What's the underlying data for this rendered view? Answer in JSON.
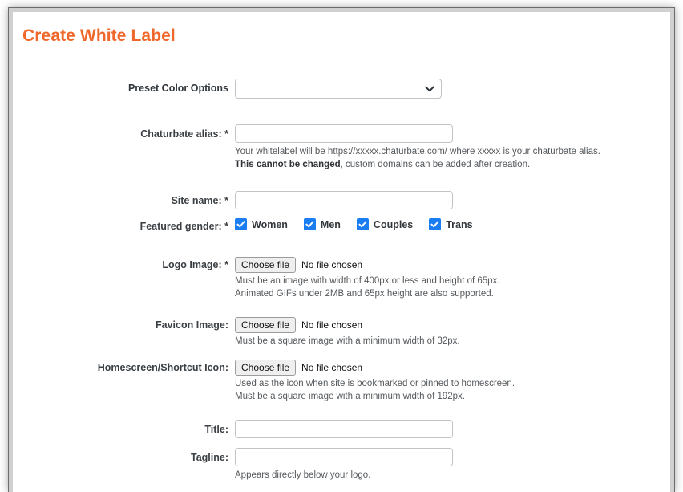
{
  "card": {
    "title": "Create White Label"
  },
  "form": {
    "preset_color": {
      "label": "Preset Color Options",
      "selected": "",
      "arrow_icon": "chevron-down-icon"
    },
    "chaturbate_alias": {
      "label": "Chaturbate alias: *",
      "value": "",
      "help_line_1": "Your whitelabel will be https://xxxxx.chaturbate.com/ where xxxxx is your chaturbate alias.",
      "help_line_2_bold": "This cannot be changed",
      "help_line_2_rest": ", custom domains can be added after creation."
    },
    "site_name": {
      "label": "Site name: *",
      "value": ""
    },
    "featured_gender": {
      "label": "Featured gender: *",
      "options": [
        {
          "label": "Women",
          "checked": true
        },
        {
          "label": "Men",
          "checked": true
        },
        {
          "label": "Couples",
          "checked": true
        },
        {
          "label": "Trans",
          "checked": true
        }
      ]
    },
    "logo_image": {
      "label": "Logo Image: *",
      "button_label": "Choose file",
      "status": "No file chosen",
      "help_line_1": "Must be an image with width of 400px or less and height of 65px.",
      "help_line_2": "Animated GIFs under 2MB and 65px height are also supported."
    },
    "favicon_image": {
      "label": "Favicon Image:",
      "button_label": "Choose file",
      "status": "No file chosen",
      "help_line_1": "Must be a square image with a minimum width of 32px."
    },
    "homescreen_icon": {
      "label": "Homescreen/Shortcut Icon:",
      "button_label": "Choose file",
      "status": "No file chosen",
      "help_line_1": "Used as the icon when site is bookmarked or pinned to homescreen.",
      "help_line_2": "Must be a square image with a minimum width of 192px."
    },
    "title_field": {
      "label": "Title:",
      "value": ""
    },
    "tagline_field": {
      "label": "Tagline:",
      "value": "",
      "help_line_1": "Appears directly below your logo."
    }
  },
  "colors": {
    "title_orange": "#f0672b",
    "checkbox_blue": "#1a7ef2",
    "label_text": "#3a3f44",
    "help_text": "#55595d"
  }
}
